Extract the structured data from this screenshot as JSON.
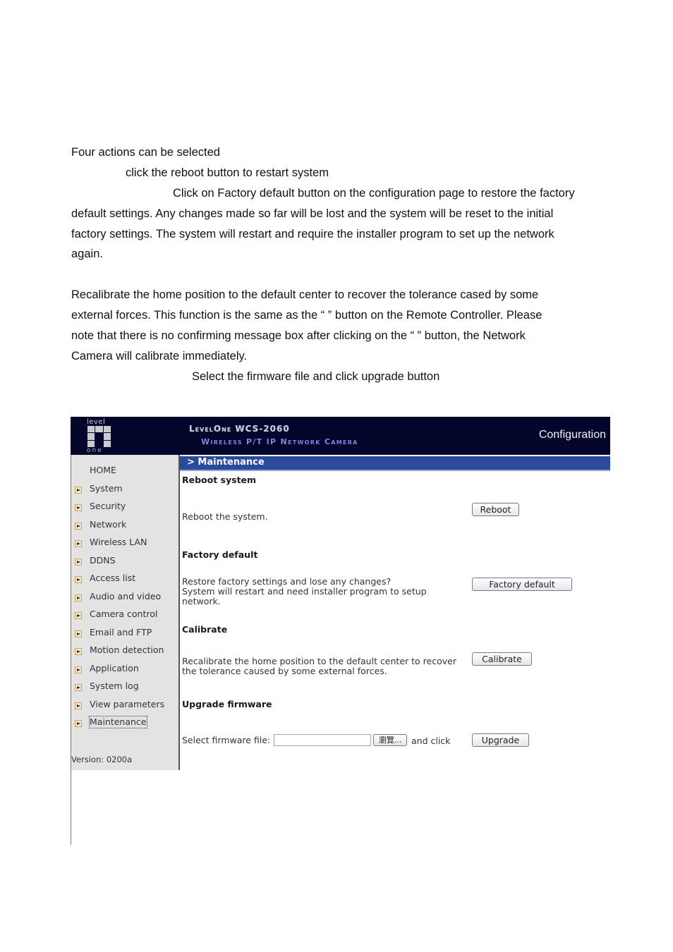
{
  "document": {
    "lines": [
      "Four actions can be selected",
      "click the reboot button to restart system",
      "Click on Factory default button on the configuration page to restore the factory",
      "default settings. Any changes made so far will be lost and the system will be reset to the initial",
      "factory settings. The system will restart and require the installer program to set up the network",
      "again.",
      "Recalibrate the home position to the default center to recover the tolerance cased by some",
      "external forces. This function is the same as the “           ” button on the Remote Controller. Please",
      "note that there is no confirming message box after clicking on the “               ” button, the Network",
      "Camera will calibrate immediately.",
      "Select the firmware file and click upgrade button"
    ]
  },
  "ui": {
    "logo": {
      "top": "level",
      "bottom": "one"
    },
    "header": {
      "title": "LevelOne WCS-2060",
      "subtitle": "Wireless P/T IP Network Camera",
      "page": "Configuration"
    },
    "breadcrumb": "> Maintenance",
    "sidebar": {
      "home": "HOME",
      "items": [
        "System",
        "Security",
        "Network",
        "Wireless LAN",
        "DDNS",
        "Access list",
        "Audio and video",
        "Camera control",
        "Email and FTP",
        "Motion detection",
        "Application",
        "System log",
        "View parameters",
        "Maintenance"
      ],
      "active": "Maintenance",
      "version": "Version: 0200a"
    },
    "sections": {
      "reboot": {
        "title": "Reboot system",
        "desc": "Reboot the system.",
        "button": "Reboot"
      },
      "factory": {
        "title": "Factory default",
        "desc_lines": [
          "Restore factory settings and lose any changes?",
          "System will restart and need installer program to setup",
          "network."
        ],
        "button": "Factory default"
      },
      "calibrate": {
        "title": "Calibrate",
        "desc_lines": [
          "Recalibrate the home position to the default center to recover",
          "the tolerance caused by some external forces."
        ],
        "button": "Calibrate"
      },
      "upgrade": {
        "title": "Upgrade firmware",
        "label": "Select firmware file:",
        "file_value": "",
        "browse": "瀏覽...",
        "and_click": "and click",
        "button": "Upgrade"
      }
    }
  }
}
